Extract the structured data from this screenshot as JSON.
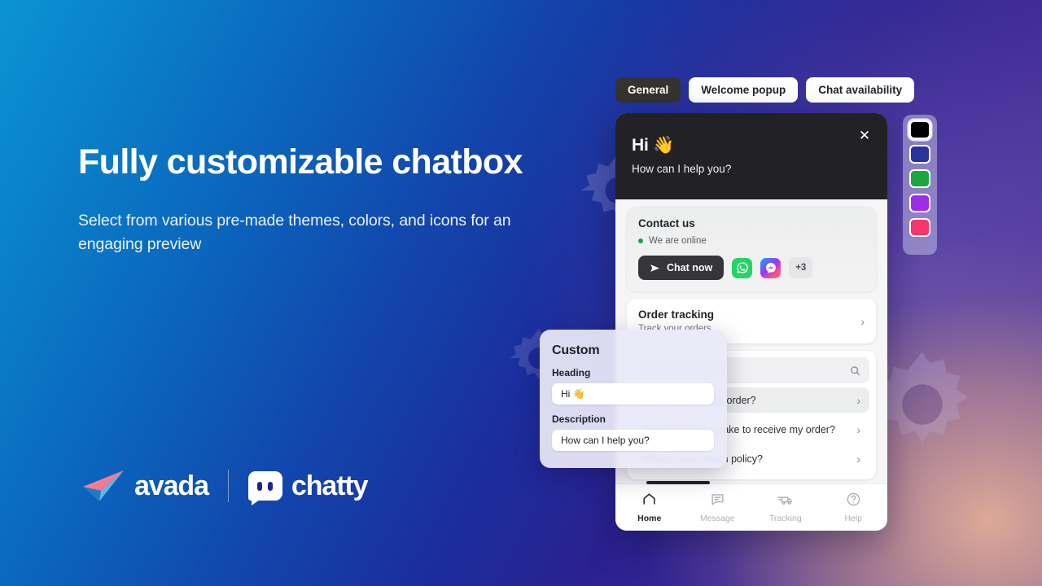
{
  "hero": {
    "headline": "Fully customizable chatbox",
    "subcopy": "Select from various pre-made themes, colors, and icons for an engaging preview"
  },
  "brands": {
    "avada": "avada",
    "chatty": "chatty"
  },
  "tabs": [
    {
      "label": "General",
      "active": true
    },
    {
      "label": "Welcome popup",
      "active": false
    },
    {
      "label": "Chat availability",
      "active": false
    }
  ],
  "widget": {
    "header": {
      "title": "Hi 👋",
      "subtitle": "How can I help you?",
      "close_icon": "close-icon"
    },
    "contact": {
      "title": "Contact us",
      "status": "We are online",
      "chat_now": "Chat now",
      "send_icon": "send-icon",
      "channels": [
        {
          "name": "whatsapp-icon"
        },
        {
          "name": "messenger-icon"
        }
      ],
      "more_label": "+3"
    },
    "order_tracking": {
      "title": "Order tracking",
      "subtitle": "Track your orders",
      "chevron": "›"
    },
    "faq": {
      "search_placeholder": "Search for help",
      "search_icon": "search-icon",
      "items": [
        {
          "question": "How do I track my order?",
          "highlighted": true
        },
        {
          "question": "How long does it take to receive my order?",
          "highlighted": false
        },
        {
          "question": "What is your return policy?",
          "highlighted": false
        }
      ],
      "chevron": "›"
    },
    "footer_nav": [
      {
        "label": "Home",
        "icon": "home-icon",
        "active": true
      },
      {
        "label": "Message",
        "icon": "message-icon",
        "active": false
      },
      {
        "label": "Tracking",
        "icon": "tracking-icon",
        "active": false
      },
      {
        "label": "Help",
        "icon": "help-icon",
        "active": false
      }
    ]
  },
  "custom_panel": {
    "title": "Custom",
    "heading_label": "Heading",
    "heading_value": "Hi 👋",
    "description_label": "Description",
    "description_value": "How can I help you?"
  },
  "swatches": [
    {
      "color": "#000000",
      "selected": true
    },
    {
      "color": "#27349b",
      "selected": false
    },
    {
      "color": "#1aa83e",
      "selected": false
    },
    {
      "color": "#9d2ee8",
      "selected": false
    },
    {
      "color": "#f7356b",
      "selected": false
    }
  ]
}
